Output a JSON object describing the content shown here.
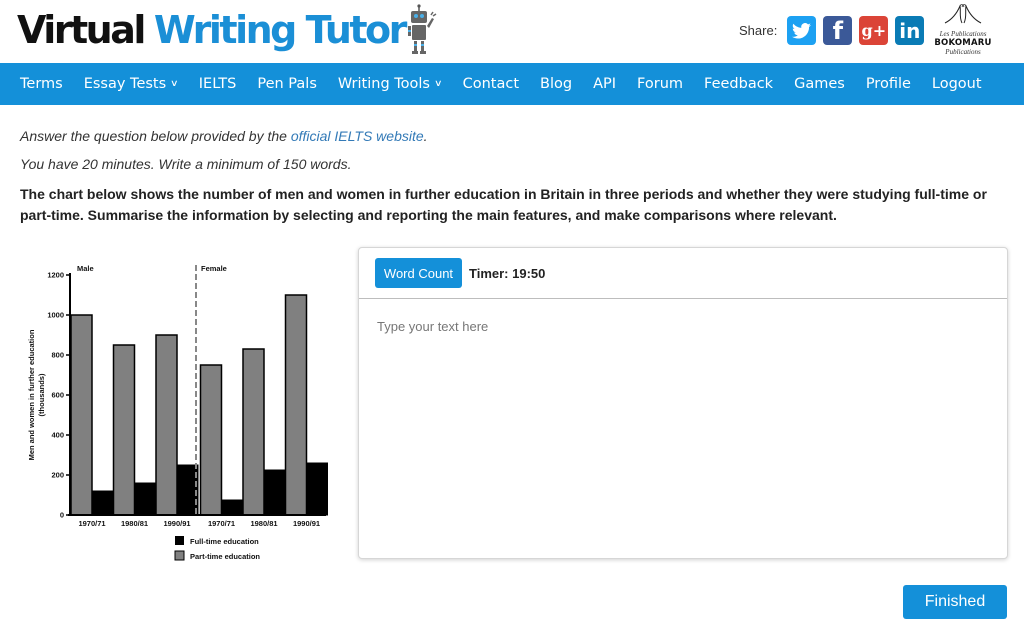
{
  "header": {
    "logo_part1": "Virtual",
    "logo_part2": "Writing Tutor",
    "logo_icon": "robot-icon",
    "share_label": "Share:",
    "social": [
      {
        "name": "twitter",
        "icon": "twitter-icon",
        "glyph": "🐦",
        "color": "#1da1f2"
      },
      {
        "name": "facebook",
        "icon": "facebook-icon",
        "glyph": "f",
        "color": "#3b5998"
      },
      {
        "name": "google-plus",
        "icon": "google-plus-icon",
        "glyph": "g+",
        "color": "#db4437"
      },
      {
        "name": "linkedin",
        "icon": "linkedin-icon",
        "glyph": "in",
        "color": "#0a7bb5"
      }
    ],
    "publisher_top": "Les Publications",
    "publisher_name": "BOKOMARU",
    "publisher_bottom": "Publications"
  },
  "nav": {
    "items": [
      {
        "label": "Terms",
        "dropdown": false
      },
      {
        "label": "Essay Tests",
        "dropdown": true
      },
      {
        "label": "IELTS",
        "dropdown": false
      },
      {
        "label": "Pen Pals",
        "dropdown": false
      },
      {
        "label": "Writing Tools",
        "dropdown": true
      },
      {
        "label": "Contact",
        "dropdown": false
      },
      {
        "label": "Blog",
        "dropdown": false
      },
      {
        "label": "API",
        "dropdown": false
      },
      {
        "label": "Forum",
        "dropdown": false
      },
      {
        "label": "Feedback",
        "dropdown": false
      },
      {
        "label": "Games",
        "dropdown": false
      },
      {
        "label": "Profile",
        "dropdown": false
      },
      {
        "label": "Logout",
        "dropdown": false
      }
    ],
    "caret_glyph": "❯",
    "bg_color": "#1490d9"
  },
  "instructions": {
    "line1_prefix": "Answer the question below provided by the ",
    "line1_link": "official IELTS website",
    "line1_suffix": ".",
    "line2": "You have 20 minutes. Write a minimum of 150 words.",
    "prompt": "The chart below shows the number of men and women in further education in Britain in three periods and whether they were studying full-time or part-time. Summarise the information by selecting and reporting the main features, and make comparisons where relevant."
  },
  "chart_data": {
    "type": "bar",
    "title": "",
    "ylabel_line1": "Men and women in further education",
    "ylabel_line2": "(thousands)",
    "xlabel": "",
    "groups": [
      "Male",
      "Female"
    ],
    "categories": [
      "1970/71",
      "1980/81",
      "1990/91",
      "1970/71",
      "1980/81",
      "1990/91"
    ],
    "series": [
      {
        "name": "Part-time education",
        "color": "#808080",
        "values": [
          1000,
          850,
          900,
          750,
          830,
          1100
        ]
      },
      {
        "name": "Full-time education",
        "color": "#000000",
        "values": [
          120,
          160,
          250,
          75,
          225,
          260
        ]
      }
    ],
    "yticks": [
      0,
      200,
      400,
      600,
      800,
      1000,
      1200
    ],
    "ylim": [
      0,
      1200
    ],
    "grid": false,
    "legend_position": "bottom",
    "legend": [
      "Full-time education",
      "Part-time education"
    ]
  },
  "editor": {
    "word_count_label": "Word Count",
    "timer_label": "Timer: 19:50",
    "text_value": "",
    "placeholder": "Type your text here"
  },
  "footer": {
    "finished_label": "Finished"
  }
}
